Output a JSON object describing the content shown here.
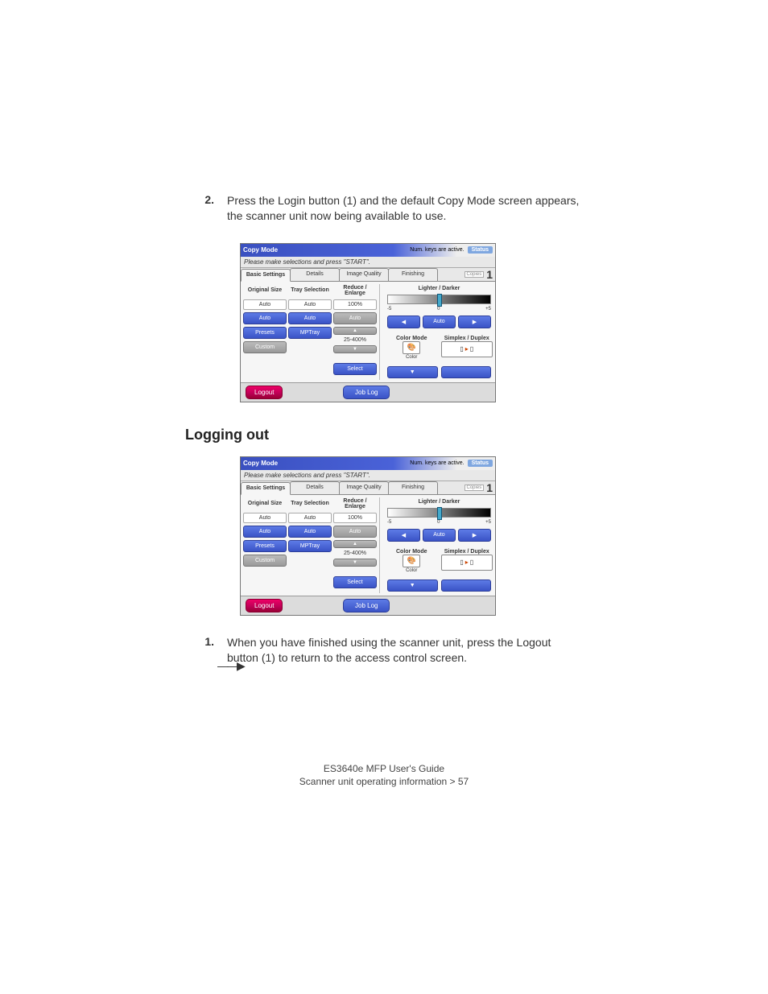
{
  "steps": {
    "first": {
      "num": "2.",
      "text": "Press the Login button (1) and the default Copy Mode screen appears, the scanner unit now being available to use."
    },
    "second": {
      "num": "1.",
      "text": "When you have finished using the scanner unit, press the Logout button (1) to return to the access control screen."
    }
  },
  "section_heading": "Logging out",
  "panel": {
    "title": "Copy Mode",
    "keys_msg": "Num. keys are active.",
    "status": "Status",
    "instruction": "Please make selections and press \"START\".",
    "tabs": [
      "Basic Settings",
      "Details",
      "Image Quality",
      "Finishing"
    ],
    "copies_label": "Copies",
    "copies_value": "1",
    "col1": {
      "hdr": "Original Size",
      "val": "Auto",
      "auto": "Auto",
      "presets": "Presets",
      "custom": "Custom"
    },
    "col2": {
      "hdr": "Tray Selection",
      "val": "Auto",
      "auto": "Auto",
      "mptray": "MPTray"
    },
    "col3": {
      "hdr": "Reduce / Enlarge",
      "val": "100%",
      "auto": "Auto",
      "range": "25-400%",
      "select": "Select"
    },
    "right": {
      "ld_hdr": "Lighter / Darker",
      "minus": "-5",
      "zero": "0",
      "plus": "+5",
      "left_arrow": "◀",
      "auto": "Auto",
      "right_arrow": "▶",
      "cm_hdr": "Color Mode",
      "color_label": "Color",
      "sd_hdr": "Simplex / Duplex",
      "down_arrow": "▼"
    },
    "logout": "Logout",
    "joblog": "Job Log"
  },
  "footer": {
    "line1": "ES3640e MFP User's Guide",
    "line2": "Scanner unit operating information > 57"
  }
}
